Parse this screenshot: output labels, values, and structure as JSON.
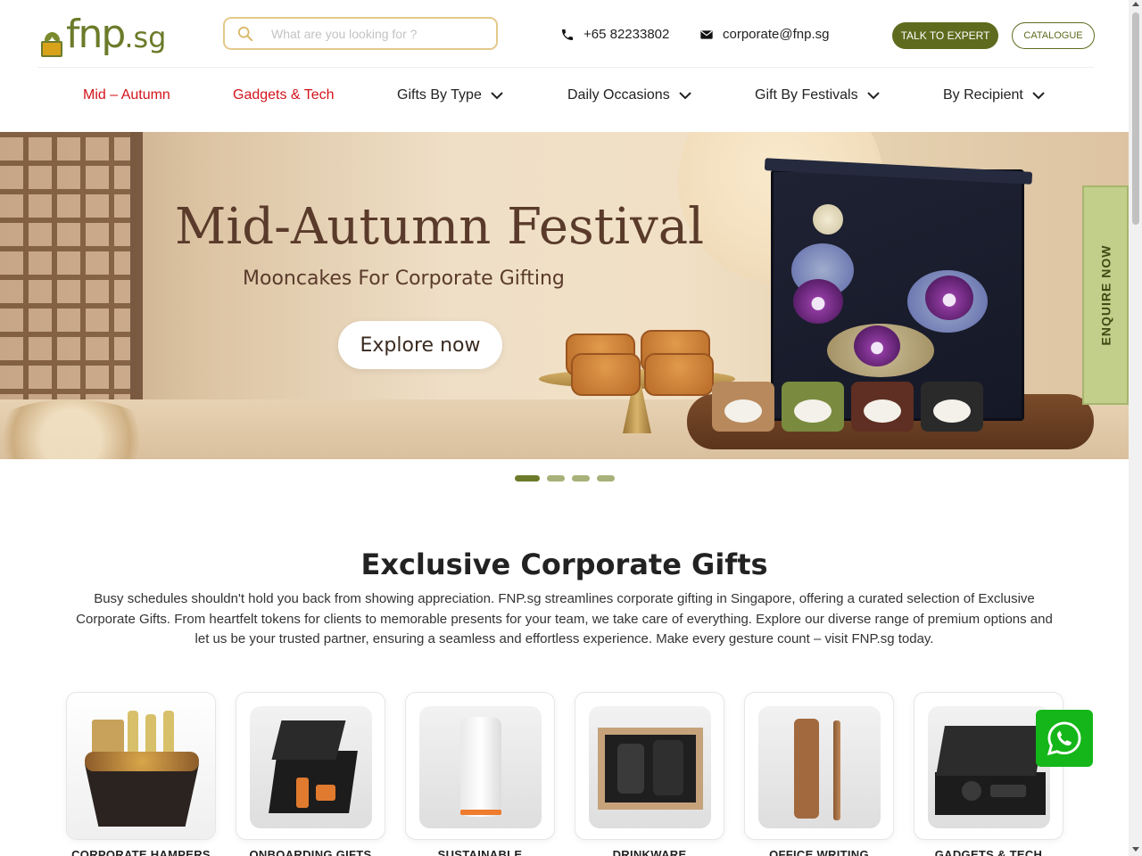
{
  "header": {
    "logo_text": "fnp",
    "logo_suffix": ".sg",
    "search_placeholder": "What are you looking for ?",
    "phone": "+65 82233802",
    "email": "corporate@fnp.sg",
    "talk_to_expert": "TALK TO EXPERT",
    "catalogue": "CATALOGUE"
  },
  "nav": {
    "items": [
      {
        "label": "Mid – Autumn",
        "highlight": true
      },
      {
        "label": "Gadgets & Tech",
        "highlight": true
      },
      {
        "label": "Gifts By Type",
        "dropdown": true
      },
      {
        "label": "Daily Occasions",
        "dropdown": true
      },
      {
        "label": "Gift By Festivals",
        "dropdown": true
      },
      {
        "label": "By Recipient",
        "dropdown": true
      }
    ]
  },
  "hero": {
    "title": "Mid-Autumn Festival",
    "subtitle": "Mooncakes For Corporate Gifting",
    "cta": "Explore now",
    "slides": 4,
    "active_slide": 1
  },
  "enquire": "ENQUIRE NOW",
  "section": {
    "title": "Exclusive Corporate Gifts",
    "description": "Busy schedules shouldn't hold you back from showing appreciation. FNP.sg streamlines corporate gifting in Singapore, offering a curated selection of Exclusive Corporate Gifts. From heartfelt tokens for clients to memorable presents for your team, we take care of everything. Explore our diverse range of premium options and let us be your trusted partner, ensuring a seamless and effortless experience. Make every gesture count – visit FNP.sg today."
  },
  "categories": [
    {
      "label": "CORPORATE HAMPERS"
    },
    {
      "label": "ONBOARDING GIFTS"
    },
    {
      "label": "SUSTAINABLE"
    },
    {
      "label": "DRINKWARE"
    },
    {
      "label": "OFFICE WRITING"
    },
    {
      "label": "GADGETS & TECH"
    }
  ],
  "colors": {
    "brand_green": "#5e6b1e",
    "nav_red": "#d3141c",
    "enquire_bg": "#c2cf8b",
    "whatsapp": "#15b619"
  }
}
